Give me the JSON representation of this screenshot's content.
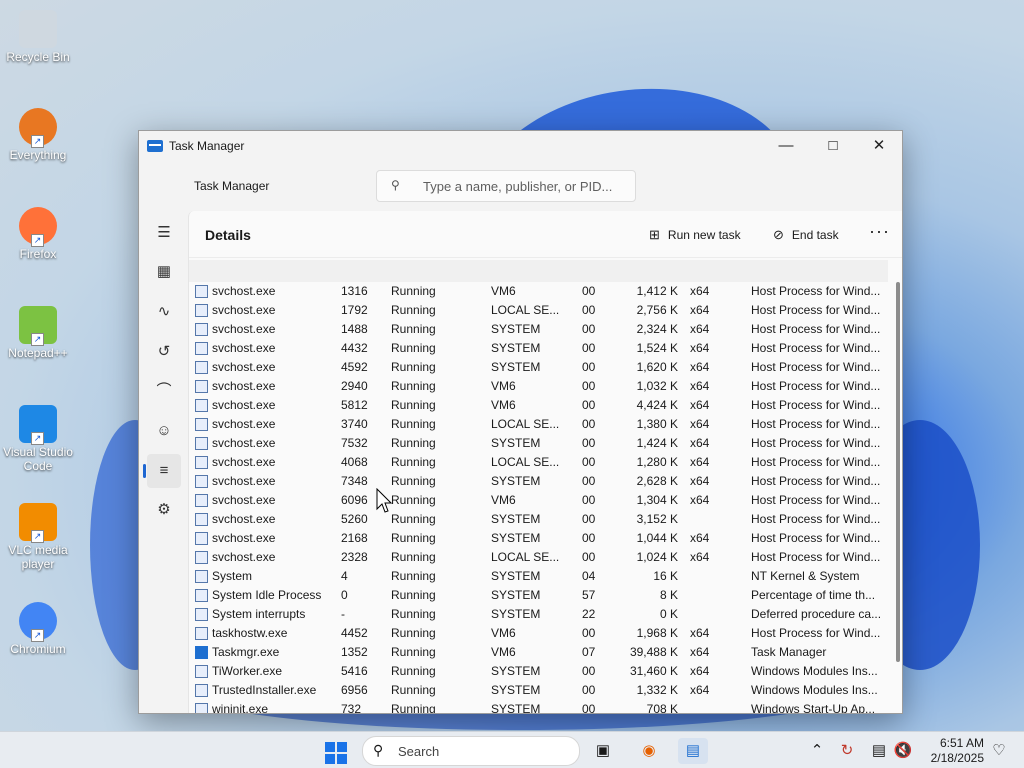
{
  "desktop": {
    "icons": [
      {
        "label": "Recycle Bin",
        "icon": "recycle-bin-icon"
      },
      {
        "label": "Everything",
        "icon": "everything-search-icon"
      },
      {
        "label": "Firefox",
        "icon": "firefox-icon"
      },
      {
        "label": "Notepad++",
        "icon": "notepad-plus-plus-icon"
      },
      {
        "label": "Visual Studio Code",
        "icon": "vscode-icon"
      },
      {
        "label": "VLC media player",
        "icon": "vlc-icon"
      },
      {
        "label": "Chromium",
        "icon": "chromium-icon"
      }
    ]
  },
  "window": {
    "title": "Task Manager",
    "header_label": "Task Manager",
    "search_placeholder": "Type a name, publisher, or PID...",
    "page_title": "Details",
    "actions": {
      "run_new_task": "Run new task",
      "end_task": "End task",
      "more": "···"
    },
    "controls": {
      "minimize": "—",
      "maximize": "□",
      "close": "✕"
    },
    "nav_icons": [
      "hamburger-menu-icon",
      "processes-icon",
      "performance-icon",
      "app-history-icon",
      "startup-apps-icon",
      "users-icon",
      "details-icon",
      "services-icon"
    ],
    "active_nav": 6
  },
  "details": {
    "rows": [
      {
        "name": "svchost.exe",
        "pid": "1316",
        "status": "Running",
        "user": "VM6",
        "cpu": "00",
        "mem": "1,412 K",
        "arch": "x64",
        "desc": "Host Process for Wind..."
      },
      {
        "name": "svchost.exe",
        "pid": "1792",
        "status": "Running",
        "user": "LOCAL SE...",
        "cpu": "00",
        "mem": "2,756 K",
        "arch": "x64",
        "desc": "Host Process for Wind..."
      },
      {
        "name": "svchost.exe",
        "pid": "1488",
        "status": "Running",
        "user": "SYSTEM",
        "cpu": "00",
        "mem": "2,324 K",
        "arch": "x64",
        "desc": "Host Process for Wind..."
      },
      {
        "name": "svchost.exe",
        "pid": "4432",
        "status": "Running",
        "user": "SYSTEM",
        "cpu": "00",
        "mem": "1,524 K",
        "arch": "x64",
        "desc": "Host Process for Wind..."
      },
      {
        "name": "svchost.exe",
        "pid": "4592",
        "status": "Running",
        "user": "SYSTEM",
        "cpu": "00",
        "mem": "1,620 K",
        "arch": "x64",
        "desc": "Host Process for Wind..."
      },
      {
        "name": "svchost.exe",
        "pid": "2940",
        "status": "Running",
        "user": "VM6",
        "cpu": "00",
        "mem": "1,032 K",
        "arch": "x64",
        "desc": "Host Process for Wind..."
      },
      {
        "name": "svchost.exe",
        "pid": "5812",
        "status": "Running",
        "user": "VM6",
        "cpu": "00",
        "mem": "4,424 K",
        "arch": "x64",
        "desc": "Host Process for Wind..."
      },
      {
        "name": "svchost.exe",
        "pid": "3740",
        "status": "Running",
        "user": "LOCAL SE...",
        "cpu": "00",
        "mem": "1,380 K",
        "arch": "x64",
        "desc": "Host Process for Wind..."
      },
      {
        "name": "svchost.exe",
        "pid": "7532",
        "status": "Running",
        "user": "SYSTEM",
        "cpu": "00",
        "mem": "1,424 K",
        "arch": "x64",
        "desc": "Host Process for Wind..."
      },
      {
        "name": "svchost.exe",
        "pid": "4068",
        "status": "Running",
        "user": "LOCAL SE...",
        "cpu": "00",
        "mem": "1,280 K",
        "arch": "x64",
        "desc": "Host Process for Wind..."
      },
      {
        "name": "svchost.exe",
        "pid": "7348",
        "status": "Running",
        "user": "SYSTEM",
        "cpu": "00",
        "mem": "2,628 K",
        "arch": "x64",
        "desc": "Host Process for Wind..."
      },
      {
        "name": "svchost.exe",
        "pid": "6096",
        "status": "Running",
        "user": "VM6",
        "cpu": "00",
        "mem": "1,304 K",
        "arch": "x64",
        "desc": "Host Process for Wind..."
      },
      {
        "name": "svchost.exe",
        "pid": "5260",
        "status": "Running",
        "user": "SYSTEM",
        "cpu": "00",
        "mem": "3,152 K",
        "arch": "",
        "desc": "Host Process for Wind..."
      },
      {
        "name": "svchost.exe",
        "pid": "2168",
        "status": "Running",
        "user": "SYSTEM",
        "cpu": "00",
        "mem": "1,044 K",
        "arch": "x64",
        "desc": "Host Process for Wind..."
      },
      {
        "name": "svchost.exe",
        "pid": "2328",
        "status": "Running",
        "user": "LOCAL SE...",
        "cpu": "00",
        "mem": "1,024 K",
        "arch": "x64",
        "desc": "Host Process for Wind..."
      },
      {
        "name": "System",
        "pid": "4",
        "status": "Running",
        "user": "SYSTEM",
        "cpu": "04",
        "mem": "16 K",
        "arch": "",
        "desc": "NT Kernel & System"
      },
      {
        "name": "System Idle Process",
        "pid": "0",
        "status": "Running",
        "user": "SYSTEM",
        "cpu": "57",
        "mem": "8 K",
        "arch": "",
        "desc": "Percentage of time th..."
      },
      {
        "name": "System interrupts",
        "pid": "-",
        "status": "Running",
        "user": "SYSTEM",
        "cpu": "22",
        "mem": "0 K",
        "arch": "",
        "desc": "Deferred procedure ca..."
      },
      {
        "name": "taskhostw.exe",
        "pid": "4452",
        "status": "Running",
        "user": "VM6",
        "cpu": "00",
        "mem": "1,968 K",
        "arch": "x64",
        "desc": "Host Process for Wind..."
      },
      {
        "name": "Taskmgr.exe",
        "pid": "1352",
        "status": "Running",
        "user": "VM6",
        "cpu": "07",
        "mem": "39,488 K",
        "arch": "x64",
        "desc": "Task Manager"
      },
      {
        "name": "TiWorker.exe",
        "pid": "5416",
        "status": "Running",
        "user": "SYSTEM",
        "cpu": "00",
        "mem": "31,460 K",
        "arch": "x64",
        "desc": "Windows Modules Ins..."
      },
      {
        "name": "TrustedInstaller.exe",
        "pid": "6956",
        "status": "Running",
        "user": "SYSTEM",
        "cpu": "00",
        "mem": "1,332 K",
        "arch": "x64",
        "desc": "Windows Modules Ins..."
      },
      {
        "name": "wininit.exe",
        "pid": "732",
        "status": "Running",
        "user": "SYSTEM",
        "cpu": "00",
        "mem": "708 K",
        "arch": "",
        "desc": "Windows Start-Up Ap..."
      }
    ]
  },
  "taskbar": {
    "search_placeholder": "Search",
    "time": "6:51 AM",
    "date": "2/18/2025",
    "tray_icons": [
      "chevron-up-icon",
      "update-icon",
      "network-icon",
      "volume-icon",
      "notification-bell-icon"
    ]
  }
}
